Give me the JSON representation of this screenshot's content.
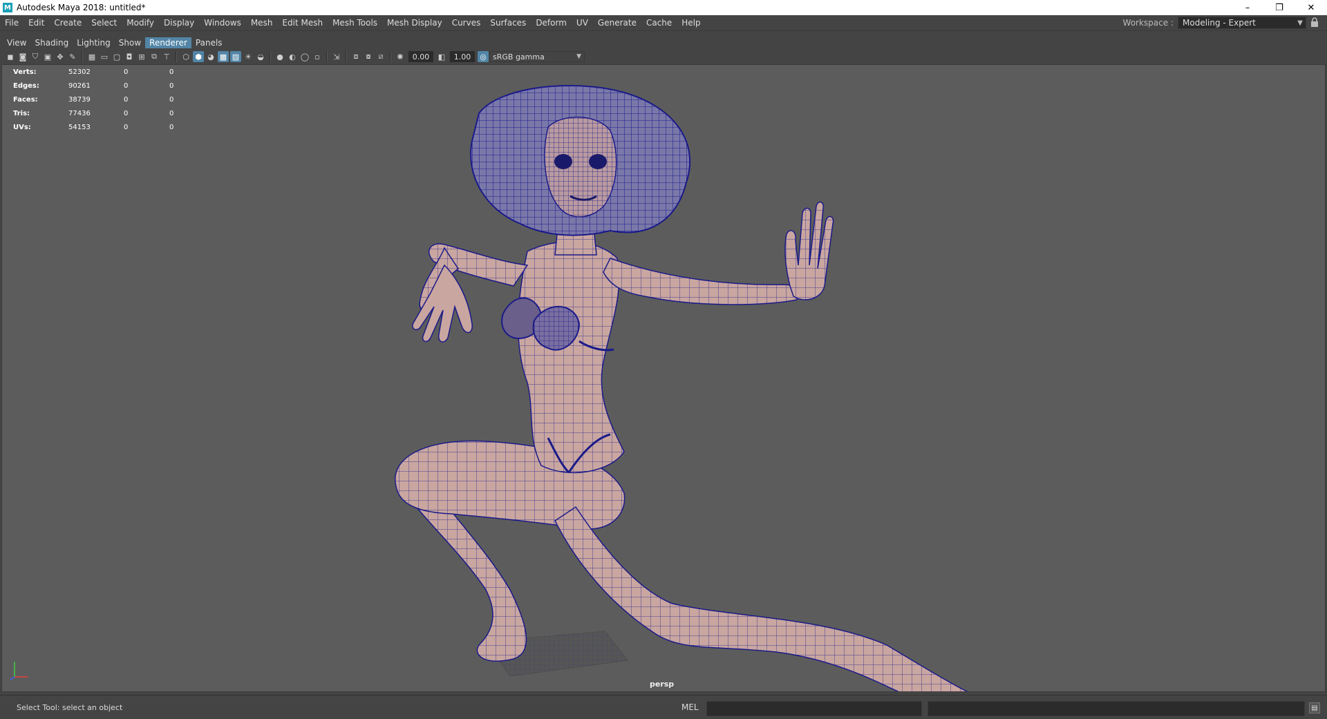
{
  "window": {
    "title": "Autodesk Maya 2018: untitled*",
    "app_icon": "M",
    "minimize": "–",
    "maximize": "❐",
    "close": "✕"
  },
  "menubar": [
    "File",
    "Edit",
    "Create",
    "Select",
    "Modify",
    "Display",
    "Windows",
    "Mesh",
    "Edit Mesh",
    "Mesh Tools",
    "Mesh Display",
    "Curves",
    "Surfaces",
    "Deform",
    "UV",
    "Generate",
    "Cache",
    "Help"
  ],
  "workspace": {
    "label": "Workspace :",
    "value": "Modeling - Expert"
  },
  "panel_menu": [
    "View",
    "Shading",
    "Lighting",
    "Show",
    "Renderer",
    "Panels"
  ],
  "panel_menu_active": "Renderer",
  "toolbar": {
    "exposure": "0.00",
    "gamma": "1.00",
    "color_space": "sRGB gamma"
  },
  "hud": [
    {
      "label": "Verts:",
      "v1": "52302",
      "v2": "0",
      "v3": "0"
    },
    {
      "label": "Edges:",
      "v1": "90261",
      "v2": "0",
      "v3": "0"
    },
    {
      "label": "Faces:",
      "v1": "38739",
      "v2": "0",
      "v3": "0"
    },
    {
      "label": "Tris:",
      "v1": "77436",
      "v2": "0",
      "v3": "0"
    },
    {
      "label": "UVs:",
      "v1": "54153",
      "v2": "0",
      "v3": "0"
    }
  ],
  "viewport": {
    "camera": "persp"
  },
  "statusbar": {
    "help_line": "Select Tool: select an object",
    "command_language": "MEL"
  },
  "colors": {
    "viewport_bg": "#5c5c5c",
    "skin": "#c9a6a0",
    "wire": "#1a1a8a",
    "accent": "#5285a6"
  }
}
